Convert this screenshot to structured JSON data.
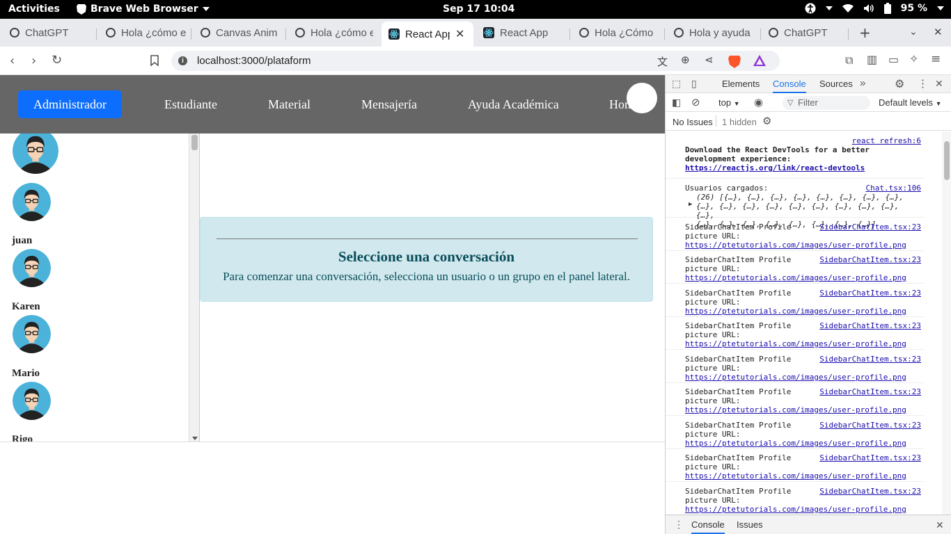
{
  "system": {
    "activities": "Activities",
    "app_name": "Brave Web Browser",
    "clock": "Sep 17  10:04",
    "battery": "95 %"
  },
  "tabs": [
    {
      "label": "ChatGPT"
    },
    {
      "label": "Hola ¿cómo e"
    },
    {
      "label": "Canvas Anim"
    },
    {
      "label": "Hola ¿cómo e"
    },
    {
      "label": "React App"
    },
    {
      "label": "React App"
    },
    {
      "label": "Hola ¿Cómo"
    },
    {
      "label": "Hola y ayuda"
    },
    {
      "label": "ChatGPT"
    }
  ],
  "address": {
    "url": "localhost:3000/plataform"
  },
  "navbar": {
    "items": [
      "Administrador",
      "Estudiante",
      "Material",
      "Mensajería",
      "Ayuda Académica",
      "Hom"
    ]
  },
  "sidebar": {
    "users": [
      "juan",
      "Karen",
      "Mario",
      "Rigo"
    ]
  },
  "main": {
    "alert_title": "Seleccione una conversación",
    "alert_text": "Para comenzar una conversación, selecciona un usuario o un grupo en el panel lateral."
  },
  "devtools": {
    "tabs": [
      "Elements",
      "Console",
      "Sources"
    ],
    "context": "top",
    "filter_placeholder": "Filter",
    "levels": "Default levels",
    "no_issues": "No Issues",
    "hidden": "1 hidden",
    "messages": {
      "devtools_src": "react refresh:6",
      "devtools_line1": "Download the React DevTools for a better",
      "devtools_line2": "development experience:",
      "devtools_link": "https://reactjs.org/link/react-devtools",
      "users_src": "Chat.tsx:106",
      "users_label": "Usuarios cargados:",
      "users_line1": "(26) [{…}, {…}, {…}, {…}, {…}, {…}, {…}, {…},",
      "users_line2": "{…}, {…}, {…}, {…}, {…}, {…}, {…}, {…}, {…}, {…},",
      "users_line3": "{…}, {…}, {…}, {…}, {…}, {…}, {…}, {…}]",
      "profile_src": "SidebarChatItem.tsx:23",
      "profile_line1": "SidebarChatItem Profile",
      "profile_line2": "picture URL:",
      "profile_link": "https://ptetutorials.com/images/user-profile.png"
    },
    "bottom_tabs": [
      "Console",
      "Issues"
    ]
  }
}
